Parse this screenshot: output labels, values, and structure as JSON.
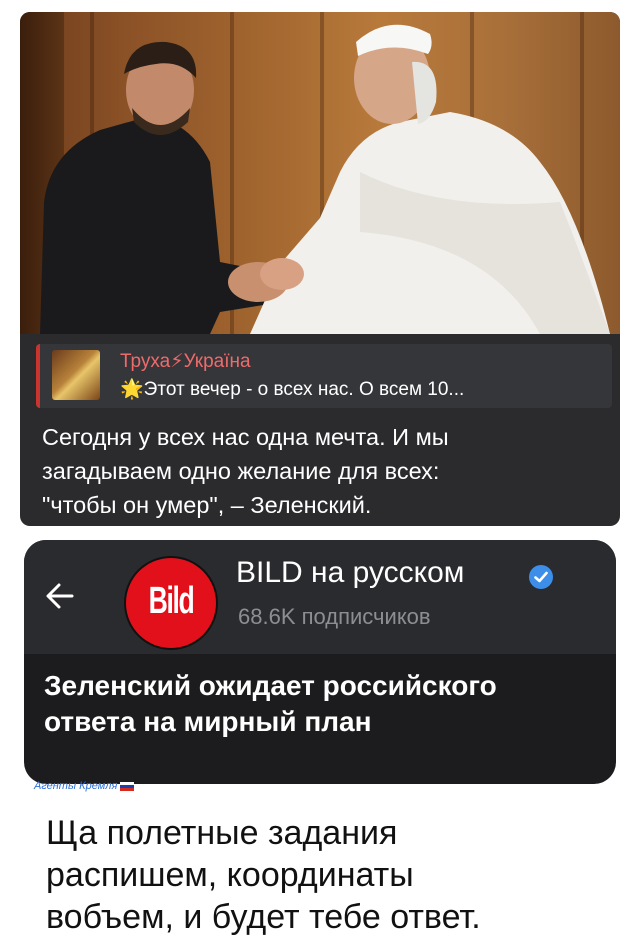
{
  "top_post": {
    "photo_alt": "photo",
    "quote": {
      "channel": "Труха⚡Україна",
      "star": "🌟",
      "text": "Этот вечер - о всех нас. О всем 10..."
    },
    "message_lines": [
      "Сегодня у всех нас одна мечта. И мы",
      "загадываем одно желание для всех:",
      "\"чтобы он умер\", – Зеленский."
    ]
  },
  "bottom_post": {
    "logo_text": "Bild",
    "channel_name": "BILD на русском",
    "subscribers": "68.6K подписчиков",
    "headline_lines": [
      "Зеленский ожидает российского",
      "ответа на мирный план"
    ]
  },
  "tag": "Агенты Кремля",
  "caption_lines": [
    "Ща полетные задания",
    "распишем, координаты",
    "вобъем, и будет тебе ответ."
  ],
  "colors": {
    "card_dark": "#2b2b2d",
    "quote_accent": "#c9342f",
    "quote_channel": "#ef6b6b",
    "bild_red": "#e2101a",
    "verified_blue": "#3d8ee8",
    "tag_blue": "#2d6fd6"
  },
  "icons": {
    "back": "back-arrow-icon",
    "verified": "verified-badge-icon",
    "flag": "russia-flag-icon"
  }
}
